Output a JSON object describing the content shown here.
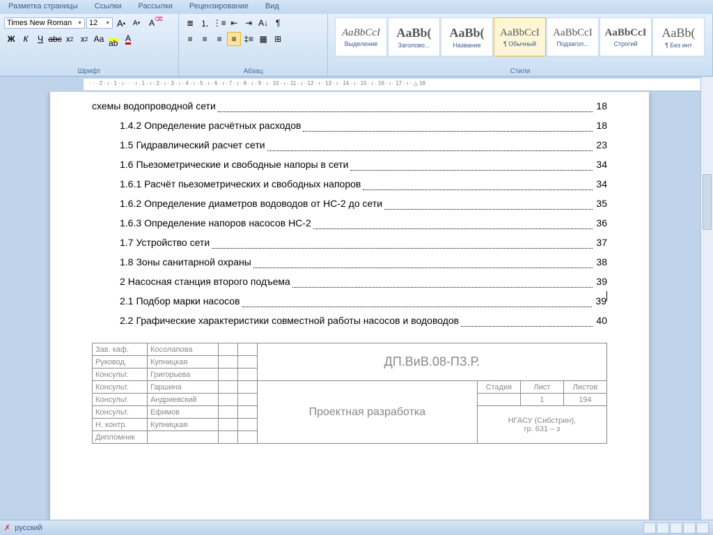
{
  "tabs": {
    "t1": "Разметка страницы",
    "t2": "Ссылки",
    "t3": "Рассылки",
    "t4": "Рецензирование",
    "t5": "Вид"
  },
  "font": {
    "name": "Times New Roman",
    "size": "12"
  },
  "groups": {
    "font": "Шрифт",
    "para": "Абзац",
    "styles": "Стили"
  },
  "styles": {
    "s1": {
      "sample": "AaBbCcI",
      "name": "Выделение"
    },
    "s2": {
      "sample": "AaBb(",
      "name": "Заголово..."
    },
    "s3": {
      "sample": "AaBb(",
      "name": "Название"
    },
    "s4": {
      "sample": "AaBbCcI",
      "name": "¶ Обычный"
    },
    "s5": {
      "sample": "AaBbCcI",
      "name": "Подзагол..."
    },
    "s6": {
      "sample": "AaBbCcI",
      "name": "Строгий"
    },
    "s7": {
      "sample": "AaBb(",
      "name": "¶ Без инт"
    }
  },
  "ruler": "· · · 2 · ı · 1 · ı · · · ı · 1 · ı · 2 · ı · 3 · ı · 4 · ı · 5 · ı · 6 · ı · 7 · ı · 8 · ı · 9 · ı · 10 · ı · 11 · ı · 12 · ı · 13 · ı · 14 · ı · 15 · ı · 16 · ı · 17 · ı · △ 18",
  "toc": [
    {
      "n": "",
      "t": "схемы водопроводной сети",
      "p": "18",
      "cls": ""
    },
    {
      "n": "1.4.2",
      "t": "Определение расчётных расходов",
      "p": "18",
      "cls": "indent1"
    },
    {
      "n": "1.5",
      "t": "Гидравлический расчет сети",
      "p": "23",
      "cls": "indent1"
    },
    {
      "n": "1.6",
      "t": "Пьезометрические и свободные напоры в сети",
      "p": "34",
      "cls": "indent1"
    },
    {
      "n": "1.6.1",
      "t": "Расчёт пьезометрических и свободных напоров",
      "p": "34",
      "cls": "indent1"
    },
    {
      "n": "1.6.2",
      "t": "Определение диаметров водоводов от НС-2 до сети",
      "p": "35",
      "cls": "indent1"
    },
    {
      "n": "1.6.3",
      "t": "Определение напоров насосов НС-2",
      "p": "36",
      "cls": "indent1"
    },
    {
      "n": "1.7",
      "t": "Устройство сети",
      "p": "37",
      "cls": "indent1"
    },
    {
      "n": "1.8",
      "t": "Зоны санитарной охраны",
      "p": "38",
      "cls": "indent1"
    },
    {
      "n": "2",
      "t": "Насосная станция второго подъема",
      "p": "39",
      "cls": "indent1"
    },
    {
      "n": "2.1",
      "t": "Подбор марки насосов",
      "p": "39",
      "cls": "indent1",
      "cursor": true
    },
    {
      "n": "2.2",
      "t": "Графические характеристики совместной работы насосов и водоводов",
      "p": "40",
      "cls": "indent1"
    }
  ],
  "stamp": {
    "r1": {
      "a": "Зав. каф.",
      "b": "Косолапова"
    },
    "r2": {
      "a": "Руковод.",
      "b": "Купницкая"
    },
    "r3": {
      "a": "Консульт.",
      "b": "Григорьева"
    },
    "r4": {
      "a": "Консульт.",
      "b": "Гаршина"
    },
    "r5": {
      "a": "Консульт.",
      "b": "Андриевский"
    },
    "r6": {
      "a": "Консульт.",
      "b": "Ефимов"
    },
    "r7": {
      "a": "Н. контр.",
      "b": "Купницкая"
    },
    "r8": {
      "a": "Дипломник",
      "b": ""
    },
    "code": "ДП.ВиВ.08-ПЗ.Р.",
    "title": "Проектная разработка",
    "h1": "Стадия",
    "h2": "Лист",
    "h3": "Листов",
    "v2": "1",
    "v3": "194",
    "org": "НГАСУ (Сибстрин),\nгр. 631 – з"
  },
  "status": {
    "lang": "русский"
  }
}
